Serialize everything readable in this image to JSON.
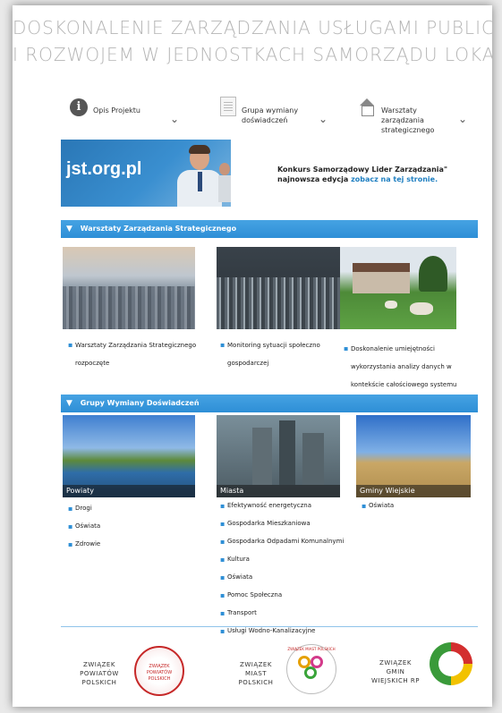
{
  "header": {
    "line1": "DOSKONALENIE ZARZĄDZANIA USŁUGAMI PUBLICZNYMI",
    "line2": "I ROZWOJEM W JEDNOSTKACH SAMORZĄDU LOKALNEGO"
  },
  "nav": [
    {
      "label": "Opis Projektu",
      "icon": "info-icon"
    },
    {
      "label": "Grupa wymiany doświadczeń",
      "icon": "document-icon"
    },
    {
      "label": "Warsztaty zarządzania strategicznego",
      "icon": "house-icon"
    }
  ],
  "banner": {
    "brand": "jst.org.pl",
    "promo_text": "Konkurs Samorządowy Lider Zarządzania\" najnowsza edycja",
    "promo_link": "zobacz na tej stronie."
  },
  "section1": {
    "title": "Warsztaty Zarządzania Strategicznego",
    "items": [
      "Warsztaty Zarządzania Strategicznego rozpoczęte",
      "Monitoring sytuacji społeczno gospodarczej",
      "Doskonalenie umiejętności wykorzystania analizy danych w kontekście całościowego systemu monitoringu"
    ]
  },
  "section2": {
    "title": "Grupy Wymiany Doświadczeń",
    "columns": [
      {
        "caption": "Powiaty",
        "items": [
          "Drogi",
          "Oświata",
          "Zdrowie"
        ]
      },
      {
        "caption": "Miasta",
        "items": [
          "Efektywność energetyczna",
          "Gospodarka Mieszkaniowa",
          "Gospodarka Odpadami Komunalnymi",
          "Kultura",
          "Oświata",
          "Pomoc Społeczna",
          "Transport",
          "Usługi Wodno-Kanalizacyjne"
        ]
      },
      {
        "caption": "Gminy Wiejskie",
        "items": [
          "Oświata"
        ]
      }
    ]
  },
  "footer": {
    "logo1": {
      "lines": [
        "ZWIĄZEK",
        "POWIATÓW",
        "POLSKICH"
      ],
      "seal_text": "ZWIĄZEK POWIATÓW POLSKICH"
    },
    "logo2": {
      "lines": [
        "ZWIĄZEK",
        "MIAST",
        "POLSKICH"
      ],
      "seal_text": "ZWIĄZEK MIAST POLSKICH"
    },
    "logo3": {
      "lines": [
        "ZWIĄZEK",
        "GMIN",
        "WIEJSKICH RP"
      ]
    }
  },
  "colors": {
    "accent": "#2e8fd6",
    "header_text": "#b5b5b5",
    "link": "#1f7fc1"
  }
}
